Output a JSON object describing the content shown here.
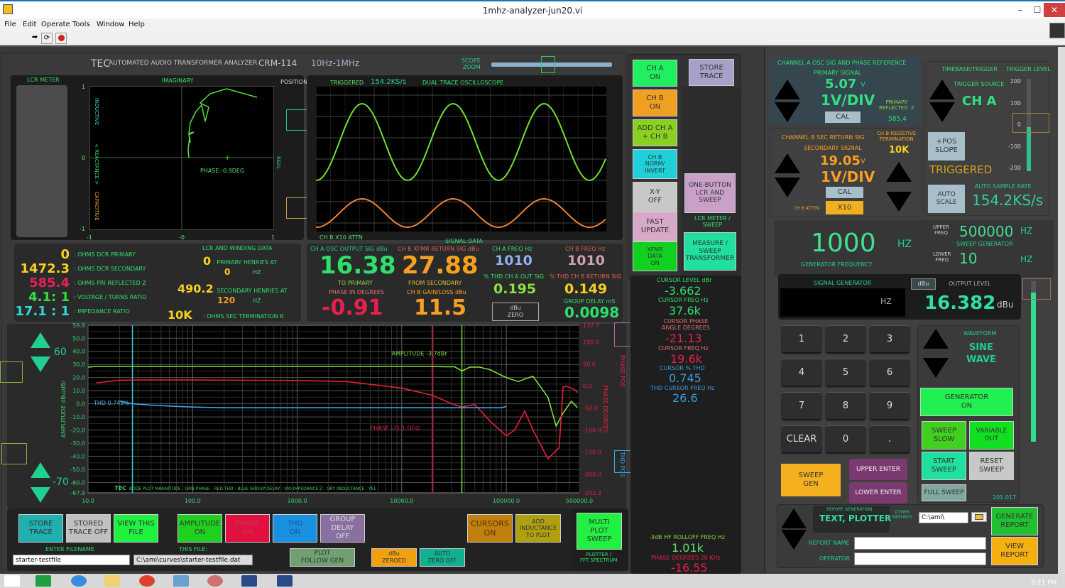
{
  "window": {
    "title": "1mhz-analyzer-jun20.vi",
    "minimize": "–",
    "maximize": "☐",
    "close": "✕"
  },
  "menu": [
    "File",
    "Edit",
    "Operate",
    "Tools",
    "Window",
    "Help"
  ],
  "toolbar": {
    "run": "run-arrow-icon",
    "run_continuous": "run-continuous-icon",
    "abort": "abort-icon"
  },
  "header": {
    "brand": "TEC",
    "product": "AUTOMATED AUDIO TRANSFORMER ANALYZER",
    "model": "CRM-114",
    "range": "10Hz-1MHz",
    "scope_zoom_label": "SCOPE\nZOOM"
  },
  "lcr": {
    "meter_label": "LCR METER",
    "xy_title": "IMAGINARY",
    "inductive": "INDUCTIVE",
    "reactance": "< REACTANCE >",
    "capacitive": "CAPACITIVE",
    "real": "REAL",
    "phase_label": "PHASE:-0.9DEG",
    "y_ticks": [
      "1",
      "0",
      "-1"
    ],
    "x_ticks": [
      "-1",
      "-0",
      "1"
    ],
    "position_label": "POSITION"
  },
  "scope": {
    "triggered": "TRIGGERED",
    "rate": "154.2KS/s",
    "title": "DUAL TRACE OSCILLOSCOPE",
    "ch_b_attn": "CH B  X10 ATTN",
    "signal_data": "SIGNAL DATA"
  },
  "winding": {
    "rows": [
      {
        "value": "0",
        "label": ": OHMS DCR PRIMARY"
      },
      {
        "value": "1472.3",
        "label": ": OHMS DCR SECONDARY"
      },
      {
        "value": "585.4",
        "label": ": OHMS  PRI  REFLECTED Z"
      },
      {
        "value": "4.1: 1",
        "label": ": VOLTAGE / TURNS RATIO"
      },
      {
        "value": "17.1 : 1",
        "label": ":  IMPEDANCE RATIO"
      }
    ],
    "title": "LCR AND WINDING  DATA",
    "pri_henries": "0",
    "pri_henries_label": ": PRIMARY HENRIES AT",
    "pri_hz": "0",
    "hz": "HZ",
    "sec_henries": "490.2",
    "sec_henries_label": ": SECONDARY HENRIES AT",
    "sec_hz": "120",
    "term": "10K",
    "term_label": ": OHMS  SEC TERMINATION  R"
  },
  "signal": {
    "cha_label": "CH A  OSC OUTPUT SIG dBu",
    "cha_value": "16.38",
    "to_primary": "TO PRIMARY",
    "phase_label": "PHASE IN DEGREES",
    "phase_value": "-0.91",
    "chb_label": "CH B XFMR RETURN SIG dBu",
    "chb_value": "27.88",
    "from_secondary": "FROM SECONDARY",
    "gain_label": "CH B GAIN/LOSS dBu",
    "gain_value": "11.5",
    "cha_freq_label": "CH A FREQ  Hz",
    "cha_freq": "1010",
    "chb_freq_label": "CH B FREQ  Hz",
    "chb_freq": "1010",
    "thd_a_label": "% THD CH A OUT SIG",
    "thd_a": "0.195",
    "thd_b_label": "% THD CH B RETURN SIG",
    "thd_b": "0.149",
    "dbu_zero": "dBu\nZERO",
    "gd_label": "GROUP DELAY mS",
    "gd_value": "0.0098"
  },
  "ch_buttons": [
    {
      "label": "CH A\nON",
      "color": "#20f060"
    },
    {
      "label": "CH B\nON",
      "color": "#f0a020"
    },
    {
      "label": "ADD CH A\n+ CH B",
      "color": "#8ad020"
    },
    {
      "label": "CH B\nNORM/\nINVERT",
      "color": "#20d0d8"
    },
    {
      "label": "X-Y\nOFF",
      "color": "#c8c8c8"
    },
    {
      "label": "FAST\nUPDATE",
      "color": "#d8a8c8"
    },
    {
      "label": "XFMR\nDATA\nON",
      "color": "#10d020"
    }
  ],
  "store_trace": "STORE\nTRACE",
  "one_button": "ONE-BUTTON\nLCR AND\nSWEEP",
  "lcr_sweep_label": "LCR METER /\nSWEEP",
  "measure_sweep": "MEASURE /\nSWEEP\nTRANSFORMER",
  "cursors": {
    "level_label": "CURSOR LEVEL dBr",
    "level": "-3.662",
    "freq_label": "CURSOR FREQ  Hz",
    "freq": "37.6k",
    "phase_label": "CURSOR PHASE\nANGLE DEGREES",
    "phase": "-21.13",
    "pfreq_label": "CURSOR FREQ  Hz",
    "pfreq": "19.6k",
    "thd_label": "CURSOR % THD",
    "thd": "0.745",
    "thdf_label": "THD CURSOR FREQ  Hz",
    "thdf": "26.6",
    "rolloff_label": "-3dB HF ROLLOFF FREQ Hz",
    "rolloff": "1.01k",
    "ph20_label": "PHASE  DEGREES 20 KHz",
    "ph20": "-16.55"
  },
  "chart_data": {
    "type": "line",
    "title": "BODE PLOT",
    "xscale": "log",
    "xlim": [
      10,
      500000
    ],
    "x_ticks": [
      "10.0",
      "100.0",
      "1000.0",
      "10000.0",
      "100000.0",
      "500000.0"
    ],
    "ylabel": "AMPLITUDE dBu/dBr",
    "ylim": [
      -67.9,
      59.9
    ],
    "y_ticks": [
      "59.9",
      "50.0",
      "40.0",
      "30.0",
      "20.0",
      "10.0",
      "0.0",
      "-10.0",
      "-20.0",
      "-30.0",
      "-40.0",
      "-50.0",
      "-60.0",
      "-67.9"
    ],
    "y2label": "PHASE DEGREES",
    "y2lim": [
      -242.3,
      137.7
    ],
    "y2_ticks": [
      "137.7",
      "100.0",
      "50.0",
      "0.0",
      "-50.0",
      "-100.0",
      "-150.0",
      "-200.0",
      "-242.3"
    ],
    "y_scale_up": "60",
    "y_scale_down": "-70",
    "legend": "BODE PLOT   MAGNITUDE : GRN    PHASE : RED    THD : BLUE  GROUP DELAY : VIO    IMPEDANCE Z : GRY    INDUCTANCE : YEL",
    "annotations": {
      "amplitude": "AMPLITUDE -3.7dBr",
      "phase": "PHASE -21.1 DEG",
      "thd": "THD 0.745%"
    },
    "cursors_hz": {
      "thd": 26.6,
      "phase": 19600,
      "amplitude": 37600
    },
    "series": [
      {
        "name": "MAGNITUDE",
        "color": "#7ee03a",
        "x": [
          10,
          12,
          20000,
          25000,
          32000,
          37600,
          45000,
          55000,
          70000,
          100000,
          130000,
          180000,
          250000,
          300000,
          350000,
          420000,
          480000
        ],
        "y": [
          28,
          28.5,
          28.5,
          28.3,
          28.3,
          25,
          28,
          28,
          26,
          20,
          17,
          21,
          5,
          -17,
          -7,
          2,
          -3
        ]
      },
      {
        "name": "PHASE",
        "color": "#e8203a",
        "x": [
          12,
          20,
          30,
          100,
          1000,
          3000,
          10000,
          19600,
          30000,
          37600,
          50000,
          70000,
          100000,
          120000,
          150000,
          180000,
          250000,
          320000,
          350000,
          380000,
          450000,
          480000
        ],
        "y": [
          7,
          13,
          13.5,
          13.5,
          12.5,
          10,
          -5,
          -21,
          -40,
          -48,
          -42,
          -80,
          -113,
          -100,
          -57,
          -100,
          -165,
          -140,
          -2,
          -1,
          -8,
          -15
        ]
      },
      {
        "name": "THD",
        "color": "#3aa8e8",
        "x": [
          20,
          26.6,
          40,
          70,
          100,
          200,
          1000,
          10000,
          50000,
          90000,
          100000
        ],
        "y": [
          2,
          0,
          -1,
          -2,
          -2.5,
          -3,
          -3,
          -3,
          -3,
          -3,
          -2
        ]
      }
    ]
  },
  "bottom_buttons": {
    "store_trace": "STORE\nTRACE",
    "stored_off": "STORED\nTRACE OFF",
    "view_file": "VIEW THIS\nFILE",
    "amplitude": "AMPLITUDE\nON",
    "phase": "PHASE\nON",
    "thd": "THD\nON",
    "group_delay": "GROUP\nDELAY\nOFF",
    "cursors": "CURSORS\nON",
    "add_inductance": "ADD\nINDUCTANCE\nTO PLOT",
    "plot_follow": "PLOT\nFOLLOW GEN",
    "dbu_zeroed": "dBu\nZEROED",
    "auto_zero": "AUTO\nZERO OFF",
    "multi_plot": "MULTI\nPLOT\nSWEEP",
    "plotter_label": "PLOTTER /\nFFT SPECTRUM",
    "enter_filename_label": "ENTER  FILENAME",
    "filename": "starter-testfile",
    "this_file_label": "THIS FILE:",
    "this_file": "C:\\ami\\curves\\starter-testfile.dat"
  },
  "chA": {
    "title": "CHANNEL A  OSC SIG AND PHASE REFERENCE",
    "primary": "PRIMARY SIGNAL",
    "volts": "5.07",
    "v": "V",
    "div": "1V/DIV",
    "cal": "CAL",
    "refl_label": "PRIMARY\nREFLECTED  Z",
    "refl": "585.4"
  },
  "chB": {
    "title": "CHANNEL B  SEC RETURN SIG",
    "secondary": "SECONDARY SIGNAL",
    "volts": "19.05",
    "v": "V",
    "div": "1V/DIV",
    "cal": "CAL",
    "atten_label": "CH B ATTEN",
    "atten": "X10",
    "term_label": "CH B RESISTIVE\nTERMINATION",
    "term": "10K"
  },
  "trigger": {
    "timebase": "TIMEBASE/TRIGGER",
    "level_label": "TRIGGER LEVEL",
    "source_label": "TRIGGER SOURCE",
    "source": "CH A",
    "slope": "+POS\nSLOPE",
    "status": "TRIGGERED",
    "auto_scale": "AUTO\nSCALE",
    "rate_label": "AUTO SAMPLE RATE",
    "rate": "154.2KS/s",
    "ticks": [
      "200",
      "100",
      "0",
      "-100",
      "-200"
    ],
    "level_fraction": 0.48
  },
  "generator": {
    "freq": "1000",
    "hz": "HZ",
    "freq_label": "GENERATOR FREQUENCY",
    "upper_label": "UPPER\nFREQ",
    "upper": "500000",
    "sweep_label": "SWEEP GENERATOR",
    "lower_label": "LOWER\nFREQ",
    "lower": "10",
    "sig_gen_label": "SIGNAL GENERATOR",
    "entry_hz": "HZ",
    "dbu_btn": "dBu",
    "output_label": "OUTPUT LEVEL",
    "output": "16.382",
    "output_unit": "dBu",
    "output_fraction": 0.93
  },
  "keypad": [
    "1",
    "2",
    "3",
    "4",
    "5",
    "6",
    "7",
    "8",
    "9",
    "CLEAR",
    "0",
    "."
  ],
  "gen_buttons": {
    "sweep_gen": "SWEEP\nGEN",
    "upper_enter": "UPPER ENTER",
    "lower_enter": "LOWER ENTER",
    "waveform_label": "WAVEFORM",
    "waveform": "SINE\nWAVE",
    "gen_on": "GENERATOR\nON",
    "sweep_slow": "SWEEP\nSLOW",
    "variable_out": "VARIABLE\nOUT",
    "start_sweep": "START\nSWEEP",
    "reset_sweep": "RESET\nSWEEP",
    "full_sweep": "FULL SWEEP",
    "version": "201.017"
  },
  "report": {
    "gen_label": "REPORT GENERATION",
    "type": "TEXT, PLOTTER",
    "other_label": "OTHER\nREPORTS",
    "path": "C:\\ami\\",
    "name_label": "REPORT NAME",
    "name": "",
    "operator_label": "OPERATOR",
    "operator": "",
    "generate": "GENERATE\nREPORT",
    "view": "VIEW\nREPORT"
  },
  "taskbar": {
    "time": "9:21 PM"
  }
}
